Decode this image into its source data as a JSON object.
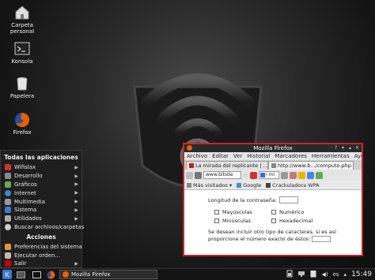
{
  "desktop": {
    "icons": [
      {
        "name": "home-folder",
        "label": "Carpeta personal"
      },
      {
        "name": "konsole",
        "label": "Konsola"
      },
      {
        "name": "trash",
        "label": "Papelera"
      },
      {
        "name": "firefox",
        "label": "Firefox"
      }
    ]
  },
  "start_menu": {
    "header": "Todas las aplicaciones",
    "items": [
      {
        "label": "Wifislax",
        "icon": "wifislax-icon",
        "color": "#c33"
      },
      {
        "label": "Desarrollo",
        "icon": "wrench-icon",
        "color": "#8a8a8a"
      },
      {
        "label": "Gráficos",
        "icon": "graphics-icon",
        "color": "#6aa84f"
      },
      {
        "label": "Internet",
        "icon": "globe-icon",
        "color": "#3d85c6"
      },
      {
        "label": "Multimedia",
        "icon": "multimedia-icon",
        "color": "#999"
      },
      {
        "label": "Sistema",
        "icon": "system-icon",
        "color": "#3c78d8"
      },
      {
        "label": "Utilidades",
        "icon": "utilities-icon",
        "color": "#aaa"
      },
      {
        "label": "Buscar archivos/carpetas",
        "icon": "search-icon",
        "color": "#ccc"
      }
    ],
    "actions_header": "Acciones",
    "actions": [
      {
        "label": "Preferencias del sistema",
        "icon": "settings-icon",
        "color": "#e69138"
      },
      {
        "label": "Ejecutar orden...",
        "icon": "run-icon",
        "color": "#bbb"
      },
      {
        "label": "Salir",
        "icon": "logout-icon",
        "color": "#cc0000"
      }
    ]
  },
  "firefox": {
    "title": "Mozilla Firefox",
    "menus": [
      "Archivo",
      "Editar",
      "Ver",
      "Historial",
      "Marcadores",
      "Herramientas",
      "Ayuda"
    ],
    "tabs": [
      {
        "label": "La mirada del replicante | ..."
      },
      {
        "label": "http://www.b.../computo.php"
      }
    ],
    "url": "www.bitsde",
    "search": "i mi",
    "bookmarks": [
      "Más visitados",
      "Google",
      "Crackuladora WPA"
    ],
    "form": {
      "length_label": "Longitud de la contraseña:",
      "options": [
        "Mayúsculas",
        "Numérico",
        "Minúsculas",
        "Hexadecimal"
      ],
      "extra_text": "Se desean incluir otro tipo de caracteres, si es así proporcione el número exacto de éstos:"
    }
  },
  "taskbar": {
    "task_label": "Mozilla Firefox",
    "keyboard_layout": "es",
    "time": "15:49"
  }
}
